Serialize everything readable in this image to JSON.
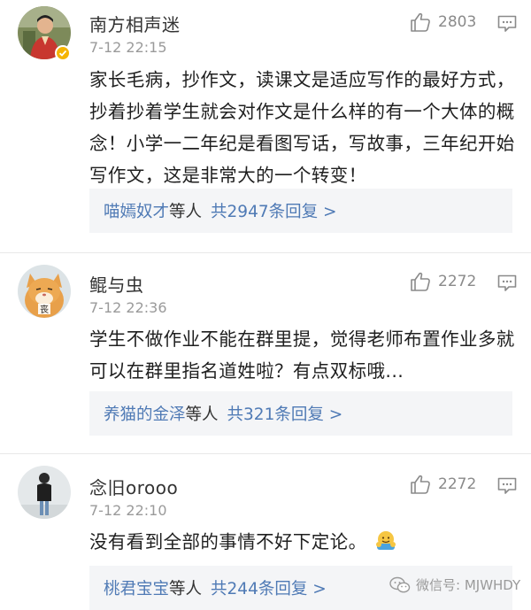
{
  "comments": [
    {
      "username": "南方相声迷",
      "time": "7-12 22:15",
      "likes": "2803",
      "text": "家长毛病，抄作文，读课文是适应写作的最好方式，抄着抄着学生就会对作文是什么样的有一个大体的概念！小学一二年纪是看图写话，写故事，三年纪开始写作文，这是非常大的一个转变！",
      "reply_names": "喵嫣奴才",
      "reply_etc": "等人",
      "reply_total": "共2947条回复 >"
    },
    {
      "username": "鲲与虫",
      "time": "7-12 22:36",
      "likes": "2272",
      "text": "学生不做作业不能在群里提，觉得老师布置作业多就可以在群里指名道姓啦？有点双标哦...",
      "reply_names": "养猫的金泽",
      "reply_etc": "等人",
      "reply_total": "共321条回复 >"
    },
    {
      "username": "念旧orooo",
      "time": "7-12 22:10",
      "likes": "2272",
      "text": "没有看到全部的事情不好下定论。",
      "reply_names": "桃君宝宝",
      "reply_etc": "等人",
      "reply_total": "共244条回复 >"
    }
  ],
  "avatar2_caption": "丧",
  "watermark": "微信号: MJWHDY",
  "colors": {
    "link": "#4f7ab5",
    "reply_bg": "#f4f5f7",
    "verified": "#f5b400"
  }
}
